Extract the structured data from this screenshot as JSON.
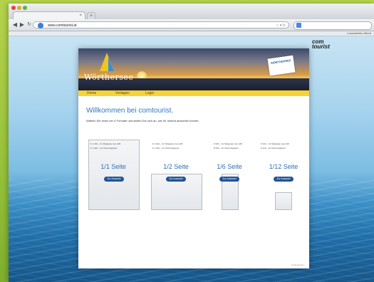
{
  "browser": {
    "tab_title": "",
    "address": "www.comtourist.at",
    "bookmark_label": "Lesezeichen-Menü"
  },
  "brand": {
    "line1": "com",
    "line2": "tourist",
    "tag": ""
  },
  "site": {
    "logo_text": "Wörthersee",
    "badge_text": "WÖRTHERSEE",
    "nav": [
      "Home",
      "Vorlagen",
      "Login"
    ],
    "headline": "Willkommen bei comtourist.",
    "intro": "Wählen Sie eines der 4 Formate und stellen Sie sich an, wie Ihr Inserat aussehen könnte.",
    "formats": [
      {
        "label": "1/1 Seite",
        "line1": "€ 1.330,– für Mitglieder des IHB",
        "line2": "€ 1.330,– für Nichtmitglieder",
        "button": "Zur Auswahl"
      },
      {
        "label": "1/2 Seite",
        "line1": "€ 1.ß10,– für Mitglieder des IHB",
        "line2": "€ 1.330,– für Nichtmitglieder",
        "button": "Zur Auswahl"
      },
      {
        "label": "1/6 Seite",
        "line1": "€ 300,– für Mitglieder des IHB",
        "line2": "€ 550,– für Nichtmitglieder",
        "button": "Zur Auswahl"
      },
      {
        "label": "1/12 Seite",
        "line1": "€ 160,– für Mitglieder des IHB",
        "line2": "€ 220,– für Nichtmitglieder",
        "button": "Zur Auswahl"
      }
    ],
    "footer": "comtourist.at"
  },
  "colors": {
    "accent": "#2f78c4",
    "nav_bar": "#f7d33a",
    "button": "#20549a",
    "frame": "#9cc63a"
  }
}
